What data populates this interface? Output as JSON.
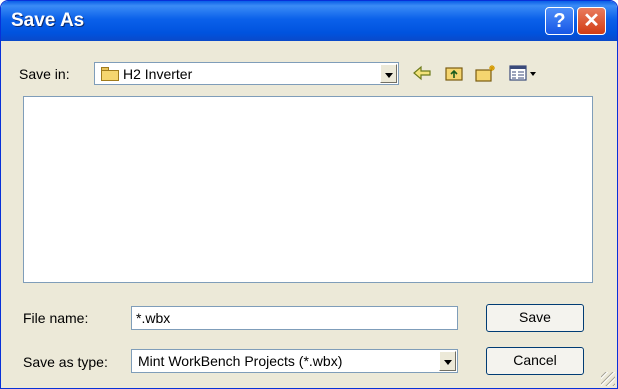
{
  "window": {
    "title": "Save As"
  },
  "titlebar": {
    "help_label": "?",
    "close_label": "✕"
  },
  "save_in": {
    "label": "Save in:",
    "value": "H2 Inverter",
    "icon": "folder-icon"
  },
  "toolbar": {
    "back_icon": "back-arrow-icon",
    "up_icon": "up-folder-icon",
    "new_folder_icon": "new-folder-icon",
    "view_icon": "view-menu-icon"
  },
  "file_name": {
    "label": "File name:",
    "value": "*.wbx"
  },
  "save_as_type": {
    "label": "Save as type:",
    "value": "Mint WorkBench Projects (*.wbx)"
  },
  "buttons": {
    "save": "Save",
    "cancel": "Cancel"
  }
}
